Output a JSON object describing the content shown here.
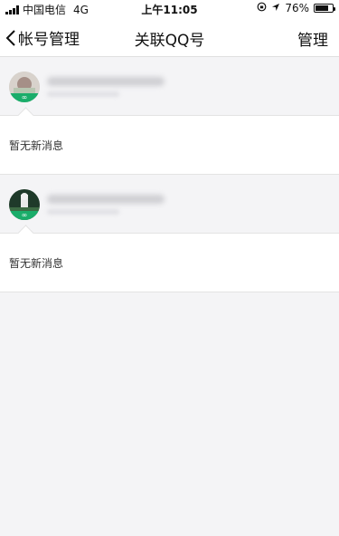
{
  "status_bar": {
    "carrier": "中国电信",
    "network": "4G",
    "time": "上午11:05",
    "battery": "76%",
    "battery_level": 0.76
  },
  "nav": {
    "back_label": "帐号管理",
    "title": "关联QQ号",
    "right_action": "管理"
  },
  "accounts": [
    {
      "message": "暂无新消息",
      "badge_icon": "infinity-icon"
    },
    {
      "message": "暂无新消息",
      "badge_icon": "infinity-icon"
    }
  ]
}
